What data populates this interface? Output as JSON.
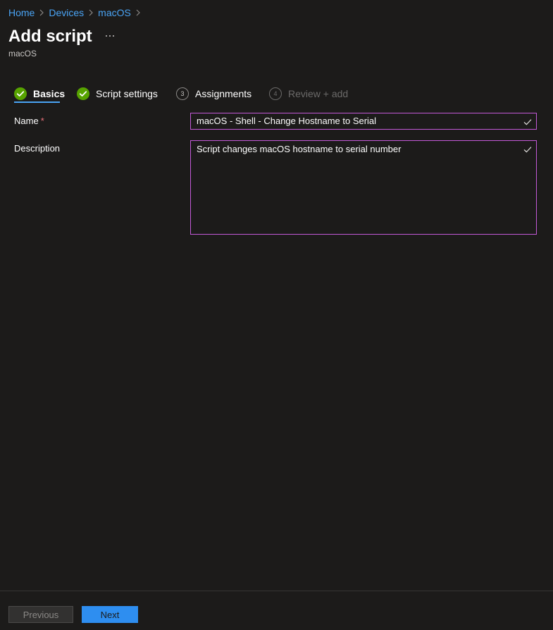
{
  "breadcrumb": {
    "items": [
      "Home",
      "Devices",
      "macOS"
    ]
  },
  "page": {
    "title": "Add script",
    "more_label": "···",
    "subtitle": "macOS"
  },
  "wizard": {
    "steps": [
      {
        "label": "Basics",
        "state": "complete",
        "number": "1"
      },
      {
        "label": "Script settings",
        "state": "complete",
        "number": "2"
      },
      {
        "label": "Assignments",
        "state": "pending",
        "number": "3"
      },
      {
        "label": "Review + add",
        "state": "disabled",
        "number": "4"
      }
    ],
    "active_step": "Basics"
  },
  "form": {
    "name": {
      "label": "Name",
      "required_mark": "*",
      "value": "macOS - Shell - Change Hostname to Serial"
    },
    "description": {
      "label": "Description",
      "value": "Script changes macOS hostname to serial number"
    }
  },
  "footer": {
    "previous_label": "Previous",
    "next_label": "Next"
  },
  "colors": {
    "background": "#1c1b1a",
    "link": "#4aa4f5",
    "success": "#57a300",
    "input_border": "#c45ad8",
    "primary_button": "#2e8ef0"
  },
  "icons": {
    "breadcrumb_separator": "chevron-right-icon",
    "step_complete": "checkmark-circle-icon",
    "field_valid": "checkmark-icon",
    "more": "more-ellipsis-icon"
  }
}
